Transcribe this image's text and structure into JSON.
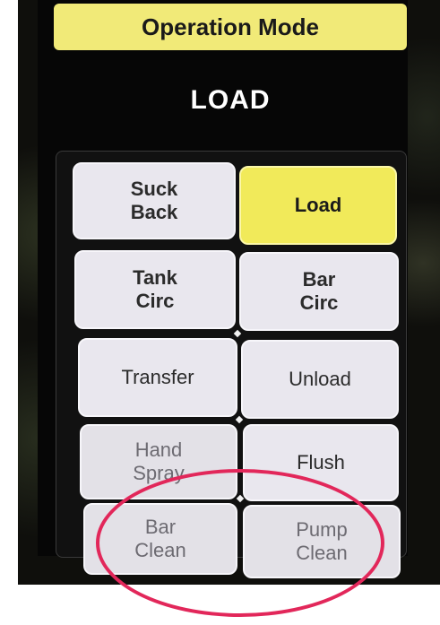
{
  "header": {
    "title": "Operation Mode"
  },
  "status": {
    "current_mode": "LOAD"
  },
  "buttons": [
    {
      "label": "Suck\nBack",
      "state": "normal"
    },
    {
      "label": "Load",
      "state": "selected"
    },
    {
      "label": "Tank\nCirc",
      "state": "normal"
    },
    {
      "label": "Bar\nCirc",
      "state": "normal"
    },
    {
      "label": "Transfer",
      "state": "normal"
    },
    {
      "label": "Unload",
      "state": "normal"
    },
    {
      "label": "Hand\nSpray",
      "state": "normal"
    },
    {
      "label": "Flush",
      "state": "normal"
    },
    {
      "label": "Bar\nClean",
      "state": "normal"
    },
    {
      "label": "Pump\nClean",
      "state": "normal"
    }
  ],
  "colors": {
    "accent_yellow": "#f1ea5a",
    "highlight_circle": "#e2275a"
  }
}
